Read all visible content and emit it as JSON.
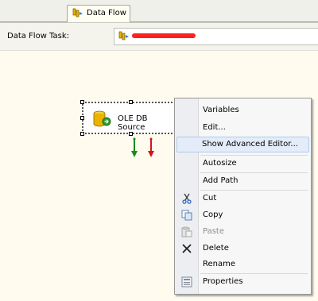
{
  "tab": {
    "label": "Data Flow",
    "icon": "data-flow-icon"
  },
  "task": {
    "label": "Data Flow Task:",
    "value": ""
  },
  "component": {
    "label": "OLE DB Source",
    "icon": "database-source-icon"
  },
  "menu": {
    "items": [
      {
        "label": "Variables"
      },
      {
        "label": "Edit..."
      },
      {
        "label": "Show Advanced Editor..."
      },
      {
        "label": "Autosize"
      },
      {
        "label": "Add Path"
      },
      {
        "label": "Cut",
        "icon": "cut-icon"
      },
      {
        "label": "Copy",
        "icon": "copy-icon"
      },
      {
        "label": "Paste",
        "icon": "paste-icon"
      },
      {
        "label": "Delete",
        "icon": "delete-icon"
      },
      {
        "label": "Rename"
      },
      {
        "label": "Properties",
        "icon": "properties-icon"
      }
    ]
  },
  "colors": {
    "canvas": "#fffbef",
    "menu_highlight": "#e3ecf8",
    "success_arrow": "#1a8a1a",
    "error_arrow": "#d01818"
  }
}
